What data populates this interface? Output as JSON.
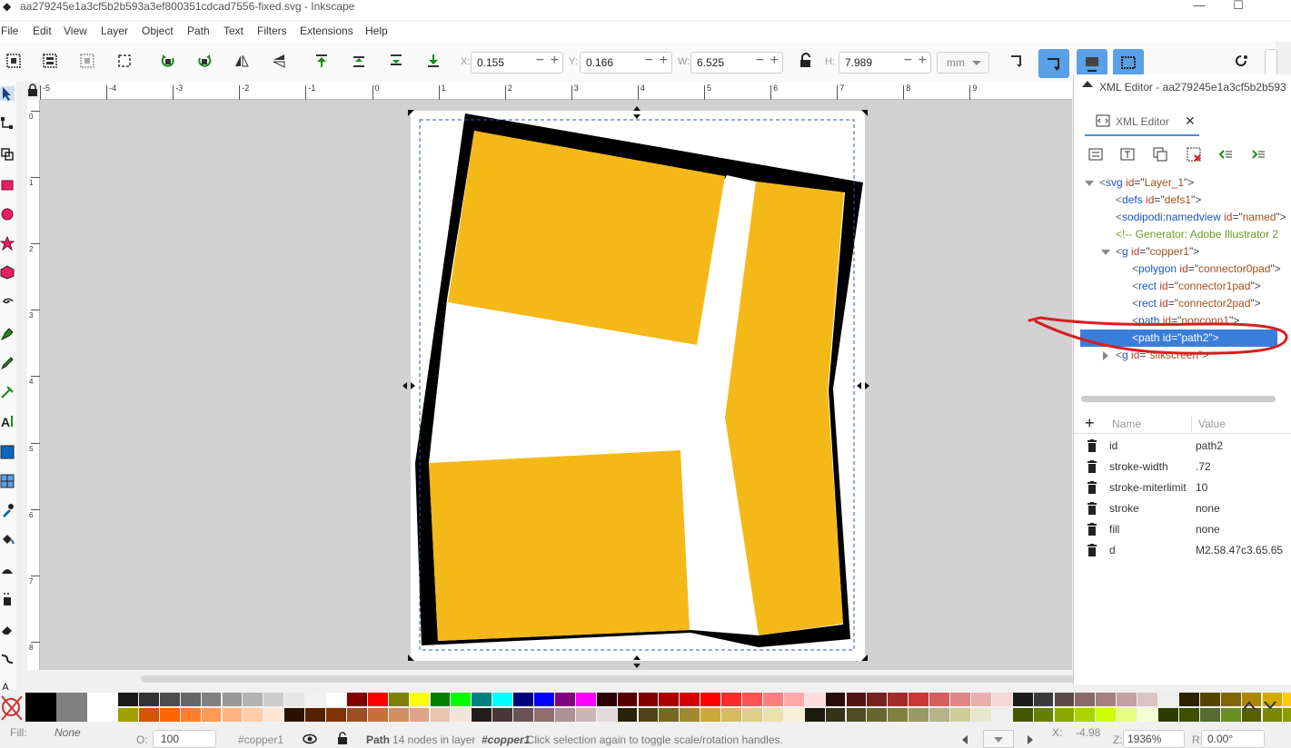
{
  "window": {
    "title": "aa279245e1a3cf5b2b593a3ef800351cdcad7556-fixed.svg - Inkscape",
    "minimize": "—",
    "maximize": "☐"
  },
  "menu": [
    "File",
    "Edit",
    "View",
    "Layer",
    "Object",
    "Path",
    "Text",
    "Filters",
    "Extensions",
    "Help"
  ],
  "toolbar": {
    "x_label": "X:",
    "x_value": "0.155",
    "y_label": "Y:",
    "y_value": "0.166",
    "w_label": "W:",
    "w_value": "6.525",
    "h_label": "H:",
    "h_value": "7.989",
    "unit": "mm",
    "minus": "−",
    "plus": "+"
  },
  "ruler_h_labels": [
    "-5",
    "-4",
    "-3",
    "-2",
    "-1",
    "0",
    "1",
    "2",
    "3",
    "4",
    "5",
    "6",
    "7",
    "8",
    "9"
  ],
  "ruler_v_labels": [
    "0",
    "1",
    "2",
    "3",
    "4",
    "5",
    "6",
    "7",
    "8"
  ],
  "xml_panel": {
    "title": "XML Editor - aa279245e1a3cf5b2b593",
    "tab_label": "XML Editor",
    "tab_close": "✕",
    "tree": [
      {
        "tag": "svg",
        "attr": "id",
        "value": "Layer_1",
        "indent": 0,
        "twisty": "open"
      },
      {
        "tag": "defs",
        "attr": "id",
        "value": "defs1",
        "indent": 1,
        "twisty": ""
      },
      {
        "tag": "sodipodi:namedview",
        "attr": "id",
        "value": "named",
        "indent": 1,
        "twisty": ""
      },
      {
        "comment": "<!-- Generator: Adobe Illustrator 2",
        "indent": 1
      },
      {
        "tag": "g",
        "attr": "id",
        "value": "copper1",
        "indent": 1,
        "twisty": "open"
      },
      {
        "tag": "polygon",
        "attr": "id",
        "value": "connector0pad",
        "indent": 2,
        "twisty": ""
      },
      {
        "tag": "rect",
        "attr": "id",
        "value": "connector1pad",
        "indent": 2,
        "twisty": ""
      },
      {
        "tag": "rect",
        "attr": "id",
        "value": "connector2pad",
        "indent": 2,
        "twisty": ""
      },
      {
        "tag": "path",
        "attr": "id",
        "value": "nonconn1",
        "indent": 2,
        "twisty": ""
      },
      {
        "tag": "path",
        "attr": "id",
        "value": "path2",
        "indent": 2,
        "twisty": "",
        "selected": true
      },
      {
        "tag": "g",
        "attr": "id",
        "value": "silkscreen",
        "indent": 1,
        "twisty": "closed"
      }
    ],
    "attr_add": "+",
    "attr_col_name": "Name",
    "attr_col_value": "Value",
    "attributes": [
      {
        "name": "id",
        "value": "path2"
      },
      {
        "name": "stroke-width",
        "value": ".72"
      },
      {
        "name": "stroke-miterlimit",
        "value": "10"
      },
      {
        "name": "stroke",
        "value": "none"
      },
      {
        "name": "fill",
        "value": "none"
      },
      {
        "name": "d",
        "value": "M2.58.47c3.65.65"
      }
    ]
  },
  "status": {
    "fill_label": "Fill:",
    "fill_value": "None",
    "o_label": "O:",
    "opacity": "100",
    "layer": "#copper1",
    "message_pre": "Path",
    "message": " 14 nodes in layer ",
    "message_layer": "#copper1",
    "message_post": ". Click selection again to toggle scale/rotation handles.",
    "x_label": "X:",
    "x_value": "-4.98",
    "z_label": "Z:",
    "zoom": "1936%",
    "r_label": "R:",
    "rotation": "0.00°"
  },
  "colors": {
    "copper": "#f4b919",
    "selection_blue": "#3a7edc",
    "annotation_red": "#d81e1e"
  }
}
